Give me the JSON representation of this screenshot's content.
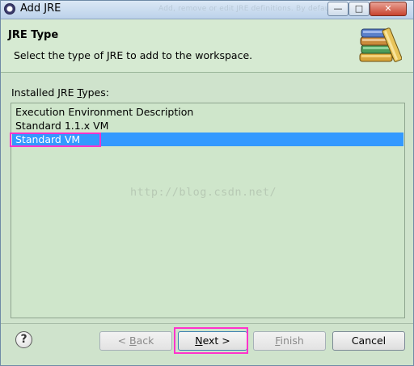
{
  "window": {
    "title": "Add JRE",
    "ghost_title": "Add, remove or edit JRE definitions. By default, the",
    "controls": {
      "minimize": "—",
      "maximize": "□",
      "close": "✕"
    }
  },
  "header": {
    "title": "JRE Type",
    "description": "Select the type of JRE to add to the workspace.",
    "icon": "jre-books-icon"
  },
  "content": {
    "types_label_pre": "Installed JRE ",
    "types_label_mnemonic": "T",
    "types_label_post": "ypes:",
    "items": [
      {
        "label": "Execution Environment Description",
        "selected": false
      },
      {
        "label": "Standard 1.1.x VM",
        "selected": false
      },
      {
        "label": "Standard VM",
        "selected": true
      }
    ],
    "watermark": "http://blog.csdn.net/"
  },
  "footer": {
    "help_icon": "?",
    "back": {
      "prefix": "< ",
      "mnemonic": "B",
      "rest": "ack",
      "enabled": false
    },
    "next": {
      "mnemonic": "N",
      "rest": "ext >",
      "enabled": true
    },
    "finish": {
      "mnemonic": "F",
      "rest": "inish",
      "enabled": false
    },
    "cancel": {
      "label": "Cancel",
      "enabled": true
    }
  },
  "colors": {
    "selection": "#3399ff",
    "highlight": "#ff33cc",
    "background": "#cfe3cc"
  }
}
